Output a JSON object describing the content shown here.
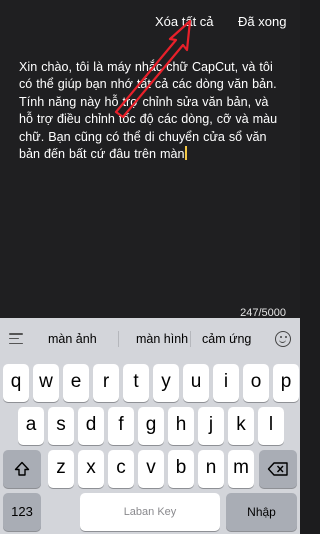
{
  "topbar": {
    "clear_label": "Xóa tất cả",
    "done_label": "Đã xong"
  },
  "editor": {
    "lines": [
      "Xin chào, tôi là máy nhắc chữ CapCut, và tôi",
      "có thể giúp bạn nhớ tất cả các dòng văn bản.",
      "Tính năng này hỗ trợ chỉnh sửa văn bản, và",
      "hỗ trợ điều chỉnh tốc độ các dòng, cỡ và màu",
      "chữ. Bạn cũng có thể di chuyển cửa sổ văn",
      "bản đến bất cứ đâu trên màn"
    ],
    "counter": "247/5000",
    "cursor_color": "#f2c744"
  },
  "keyboard": {
    "suggestions": [
      "màn ảnh",
      "màn hình",
      "cảm ứng"
    ],
    "row1": [
      "q",
      "w",
      "e",
      "r",
      "t",
      "y",
      "u",
      "i",
      "o",
      "p"
    ],
    "row2": [
      "a",
      "s",
      "d",
      "f",
      "g",
      "h",
      "j",
      "k",
      "l"
    ],
    "row3": [
      "z",
      "x",
      "c",
      "v",
      "b",
      "n",
      "m"
    ],
    "numbers_label": "123",
    "space_label": "Laban Key",
    "enter_label": "Nhập",
    "icons": [
      "menu-icon",
      "emoji-icon",
      "shift-icon",
      "backspace-icon",
      "globe-icon",
      "mic-icon"
    ]
  },
  "annotation_color": "#e8202a"
}
